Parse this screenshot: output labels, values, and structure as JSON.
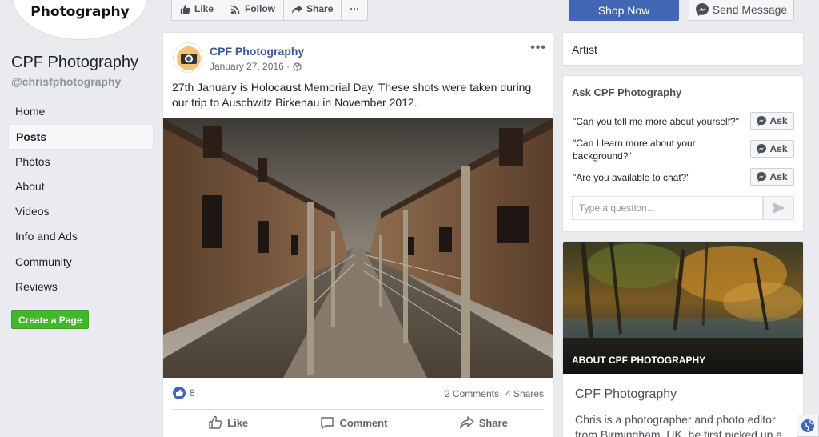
{
  "profile": {
    "logo_text": "Photography",
    "name": "CPF Photography",
    "handle": "@chrisfphotography"
  },
  "nav": {
    "items": [
      {
        "label": "Home",
        "active": false
      },
      {
        "label": "Posts",
        "active": true
      },
      {
        "label": "Photos",
        "active": false
      },
      {
        "label": "About",
        "active": false
      },
      {
        "label": "Videos",
        "active": false
      },
      {
        "label": "Info and Ads",
        "active": false
      },
      {
        "label": "Community",
        "active": false
      },
      {
        "label": "Reviews",
        "active": false
      }
    ],
    "create_page": "Create a Page"
  },
  "action_bar": {
    "like": "Like",
    "follow": "Follow",
    "share": "Share",
    "more": "···",
    "shop_now": "Shop Now",
    "send_message": "Send Message"
  },
  "post": {
    "author": "CPF Photography",
    "date": "January 27, 2016 ·",
    "more": "•••",
    "text": "27th January is Holocaust Memorial Day. These shots were taken during our trip to Auschwitz Birkenau in November 2012.",
    "reaction_count": "8",
    "comments": "2 Comments",
    "shares": "4 Shares",
    "actions": {
      "like": "Like",
      "comment": "Comment",
      "share": "Share"
    }
  },
  "sidebar": {
    "category": "Artist",
    "ask": {
      "title": "Ask CPF Photography",
      "questions": [
        {
          "text": "\"Can you tell me more about yourself?\"",
          "button": "Ask"
        },
        {
          "text": "\"Can I learn more about your background?\"",
          "button": "Ask"
        },
        {
          "text": "\"Are you available to chat?\"",
          "button": "Ask"
        }
      ],
      "input_placeholder": "Type a question..."
    },
    "about": {
      "overlay": "About CPF Photography",
      "name": "CPF Photography",
      "description": "Chris is a photographer and photo editor from Birmingham, UK, he first picked up a"
    }
  },
  "colors": {
    "brand_blue": "#4267b2",
    "link_blue": "#365899",
    "green": "#42b72a",
    "background": "#e9ebee"
  }
}
